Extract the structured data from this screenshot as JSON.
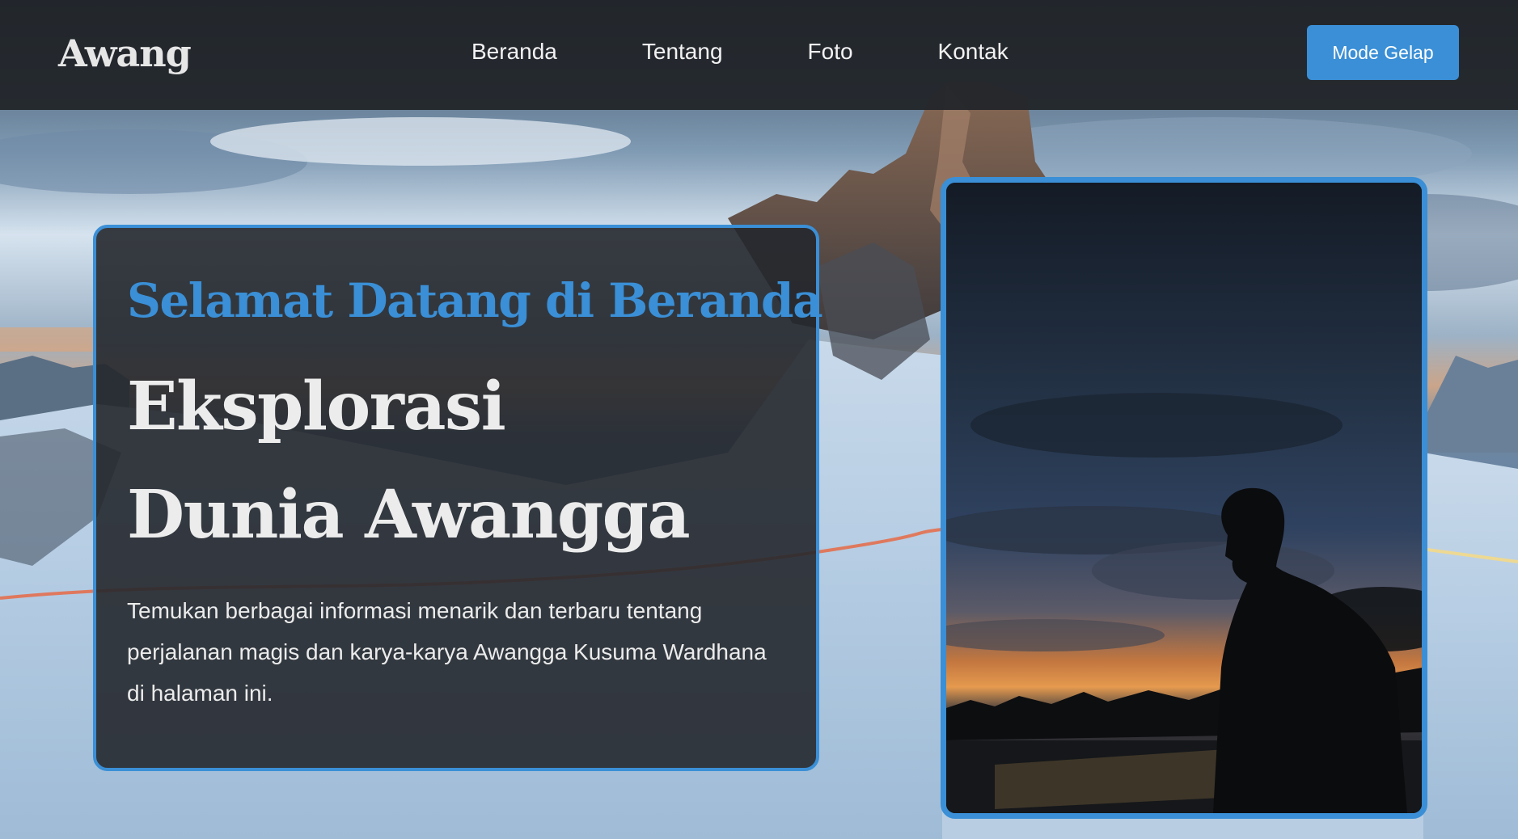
{
  "navbar": {
    "brand": "Awang",
    "links": [
      {
        "label": "Beranda"
      },
      {
        "label": "Tentang"
      },
      {
        "label": "Foto"
      },
      {
        "label": "Kontak"
      }
    ],
    "mode_button": "Mode Gelap"
  },
  "hero": {
    "eyebrow": "Selamat Datang di Beranda",
    "title": "Eksplorasi Dunia Awangga",
    "description": "Temukan berbagai informasi menarik dan terbaru tentang perjalanan magis dan karya-karya Awangga Kusuma Wardhana di halaman ini."
  },
  "icons": {
    "background": "snowy-mountain-landscape",
    "portrait": "silhouette-sunset-photo"
  },
  "colors": {
    "accent": "#3a8fd6",
    "navbar_bg": "#212428",
    "card_bg": "#25282d",
    "text_light": "#ececec"
  }
}
